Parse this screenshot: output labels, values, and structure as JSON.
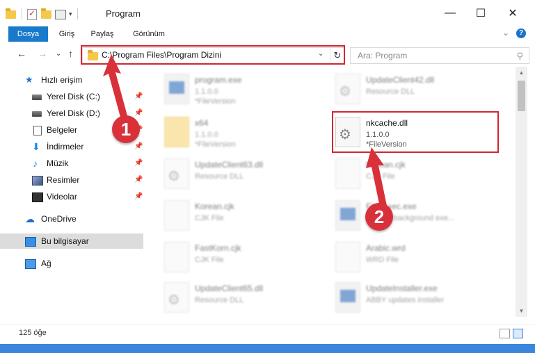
{
  "window": {
    "title": "Program",
    "minimize": "—",
    "maximize": "☐",
    "close": "✕"
  },
  "ribbon": {
    "tabs": [
      "Dosya",
      "Giriş",
      "Paylaş",
      "Görünüm"
    ],
    "expand": "⌄",
    "help": "?"
  },
  "nav": {
    "back": "←",
    "forward": "→",
    "recent": "⌄",
    "up": "↑",
    "address": "C:\\Program Files\\Program Dizini",
    "address_chevron": "⌄",
    "refresh": "↻",
    "search_placeholder": "Ara: Program",
    "search_icon": "⚲"
  },
  "sidebar": {
    "items": [
      {
        "label": "Hızlı erişim",
        "icon": "star-icon"
      },
      {
        "label": "Yerel Disk (C:)",
        "icon": "drive-icon",
        "pinned": true
      },
      {
        "label": "Yerel Disk (D:)",
        "icon": "drive-icon",
        "pinned": true
      },
      {
        "label": "Belgeler",
        "icon": "document-icon",
        "pinned": true
      },
      {
        "label": "İndirmeler",
        "icon": "download-icon",
        "pinned": true
      },
      {
        "label": "Müzik",
        "icon": "music-icon",
        "pinned": true
      },
      {
        "label": "Resimler",
        "icon": "pictures-icon",
        "pinned": true
      },
      {
        "label": "Videolar",
        "icon": "videos-icon",
        "pinned": true
      },
      {
        "label": "OneDrive",
        "icon": "cloud-icon"
      },
      {
        "label": "Bu bilgisayar",
        "icon": "computer-icon",
        "selected": true
      },
      {
        "label": "Ağ",
        "icon": "network-icon"
      }
    ],
    "pin_glyph": "📌"
  },
  "files": [
    {
      "name": "program.exe",
      "line2": "1.1.0.0",
      "line3": "*FileVersion",
      "icon": "exe"
    },
    {
      "name": "UpdateClient42.dll",
      "line2": "Resource DLL",
      "line3": "",
      "icon": "dll"
    },
    {
      "name": "x64",
      "line2": "1.1.0.0",
      "line3": "*FileVersion",
      "icon": "folder"
    },
    {
      "name": "nkcache.dll",
      "line2": "1.1.0.0",
      "line3": "*FileVersion",
      "icon": "dll"
    },
    {
      "name": "UpdateClient63.dll",
      "line2": "Resource DLL",
      "line3": "",
      "icon": "dll"
    },
    {
      "name": "Korean.cjk",
      "line2": "CJK File",
      "line3": "",
      "icon": "file"
    },
    {
      "name": "Korean.cjk",
      "line2": "CJK File",
      "line3": "",
      "icon": "file"
    },
    {
      "name": "FineExec.exe",
      "line2": "ABBYY background exe...",
      "line3": "",
      "icon": "exe"
    },
    {
      "name": "FastKorn.cjk",
      "line2": "CJK File",
      "line3": "",
      "icon": "file"
    },
    {
      "name": "Arabic.wrd",
      "line2": "WRD File",
      "line3": "",
      "icon": "file"
    },
    {
      "name": "UpdateClient65.dll",
      "line2": "Resource DLL",
      "line3": "",
      "icon": "dll"
    },
    {
      "name": "UpdateInstaller.exe",
      "line2": "ABBY updates installer",
      "line3": "",
      "icon": "exe"
    }
  ],
  "status": {
    "count": "125 öğe"
  },
  "callouts": [
    "1",
    "2"
  ],
  "colors": {
    "accent": "#1979ca",
    "highlight": "#d3252e"
  }
}
